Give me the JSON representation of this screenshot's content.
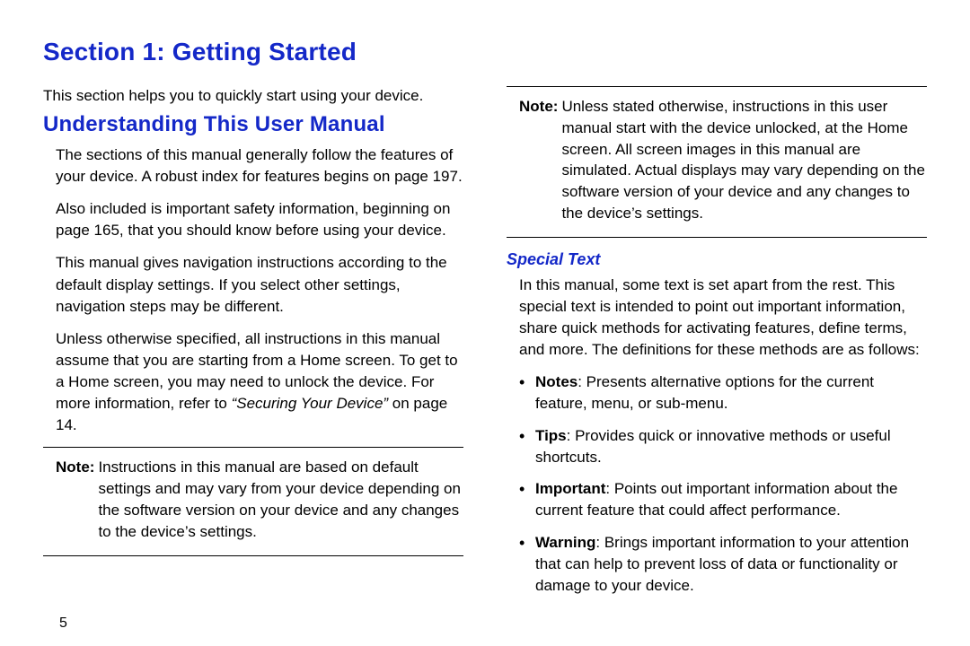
{
  "section_title": "Section 1: Getting Started",
  "left": {
    "intro": "This section helps you to quickly start using your device.",
    "subsection_title": "Understanding This User Manual",
    "p1": "The sections of this manual generally follow the features of your device. A robust index for features begins on page 197.",
    "p2": "Also included is important safety information, beginning on page 165, that you should know before using your device.",
    "p3": "This manual gives navigation instructions according to the default display settings. If you select other settings, navigation steps may be different.",
    "p4_pre": "Unless otherwise specified, all instructions in this manual assume that you are starting from a Home screen. To get to a Home screen, you may need to unlock the device. For more information, refer to ",
    "p4_ref": "“Securing Your Device”",
    "p4_post": " on page 14.",
    "note_label": "Note:",
    "note_text": " Instructions in this manual are based on default settings and may vary from your device depending on the software version on your device and any changes to the device’s settings."
  },
  "right": {
    "note_label": "Note:",
    "note_text": " Unless stated otherwise, instructions in this user manual start with the device unlocked, at the Home screen. All screen images in this manual are simulated. Actual displays may vary depending on the software version of your device and any changes to the device’s settings.",
    "subsubsection_title": "Special Text",
    "p1": "In this manual, some text is set apart from the rest. This special text is intended to point out important information, share quick methods for activating features, define terms, and more. The definitions for these methods are as follows:",
    "bullets": [
      {
        "label": "Notes",
        "text": ": Presents alternative options for the current feature, menu, or sub-menu."
      },
      {
        "label": "Tips",
        "text": ": Provides quick or innovative methods or useful shortcuts."
      },
      {
        "label": "Important",
        "text": ": Points out important information about the current feature that could affect performance."
      },
      {
        "label": "Warning",
        "text": ": Brings important information to your attention that can help to prevent loss of data or functionality or damage to your device."
      }
    ]
  },
  "page_number": "5"
}
